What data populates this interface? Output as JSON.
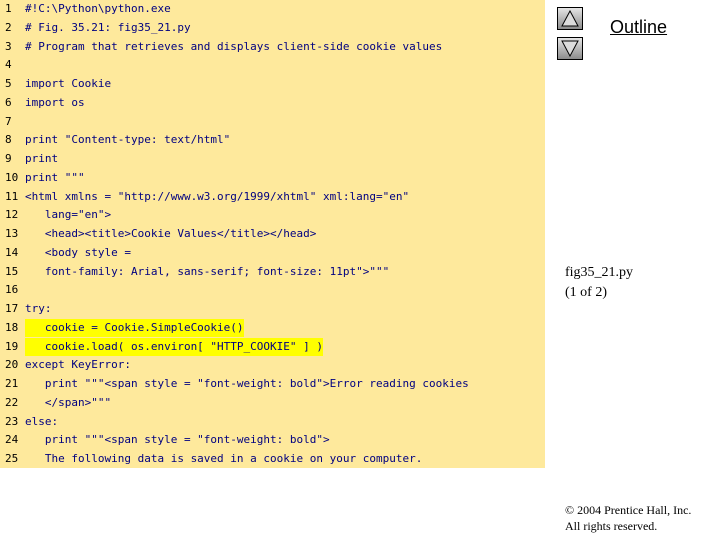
{
  "code": {
    "line_numbers": [
      "1",
      "2",
      "3",
      "4",
      "5",
      "6",
      "7",
      "8",
      "9",
      "10",
      "11",
      "12",
      "13",
      "14",
      "15",
      "16",
      "17",
      "18",
      "19",
      "20",
      "21",
      "22",
      "23",
      "24",
      "25"
    ],
    "lines": [
      "#!C:\\Python\\python.exe",
      "# Fig. 35.21: fig35_21.py",
      "# Program that retrieves and displays client-side cookie values",
      "",
      "import Cookie",
      "import os",
      "",
      "print \"Content-type: text/html\"",
      "print",
      "print \"\"\"",
      "<html xmlns = \"http://www.w3.org/1999/xhtml\" xml:lang=\"en\"",
      "   lang=\"en\">",
      "   <head><title>Cookie Values</title></head>",
      "   <body style =",
      "   font-family: Arial, sans-serif; font-size: 11pt\">\"\"\"",
      "",
      "try:",
      "   cookie = Cookie.SimpleCookie()",
      "   cookie.load( os.environ[ \"HTTP_COOKIE\" ] )",
      "except KeyError:",
      "   print \"\"\"<span style = \"font-weight: bold\">Error reading cookies",
      "   </span>\"\"\"",
      "else:",
      "   print \"\"\"<span style = \"font-weight: bold\">",
      "   The following data is saved in a cookie on your computer."
    ]
  },
  "nav": {
    "up_icon": "triangle-up-icon",
    "down_icon": "triangle-down-icon"
  },
  "outline_label": "Outline",
  "file_label": {
    "name": "fig35_21.py",
    "page": "(1 of 2)"
  },
  "copyright": {
    "line1": "© 2004 Prentice Hall, Inc.",
    "line2": "All rights reserved."
  },
  "colors": {
    "code_background": "#fee99c",
    "highlight": "#ffff00",
    "keyword": "#000080",
    "comment": "#000080",
    "string": "#000080"
  }
}
